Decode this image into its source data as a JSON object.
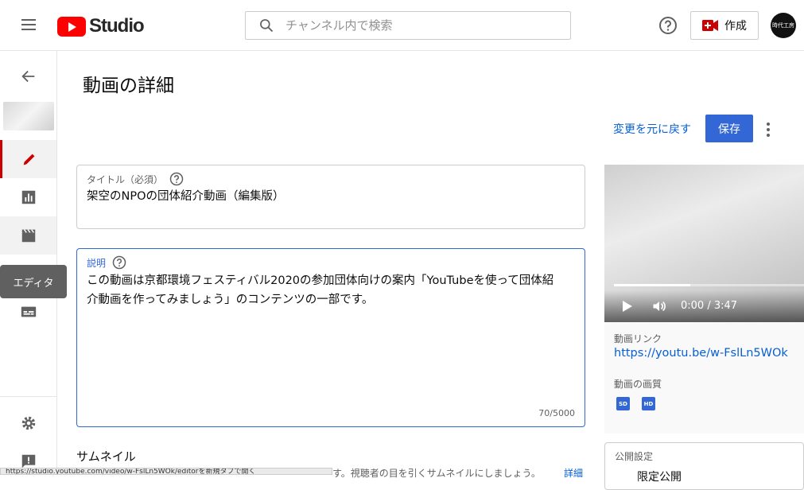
{
  "header": {
    "logo_text": "Studio",
    "search_placeholder": "チャンネル内で検索",
    "create_label": "作成",
    "avatar_text": "時代工房"
  },
  "sidebar": {
    "tooltip": "エディタ"
  },
  "main": {
    "page_title": "動画の詳細",
    "undo_label": "変更を元に戻す",
    "save_label": "保存",
    "title_field": {
      "label": "タイトル（必須）",
      "value": "架空のNPOの団体紹介動画（編集版）"
    },
    "description_field": {
      "label": "説明",
      "line1": "この動画は京都環境フェスティバル2020の参加団体向けの案内「YouTubeを使って団体紹",
      "line2": "介動画を作ってみましょう」のコンテンツの一部です。",
      "counter": "70/5000"
    },
    "thumbnail": {
      "heading": "サムネイル",
      "description": "す。視聴者の目を引くサムネイルにしましょう。",
      "more_link": "詳細"
    },
    "status_url": "https://studio.youtube.com/video/w-FslLn5WOk/editorを新規タブで開く"
  },
  "video": {
    "time": "0:00 / 3:47",
    "progress": 0.4,
    "link_label": "動画リンク",
    "link": "https://youtu.be/w-FslLn5WOk",
    "quality_label": "動画の画質",
    "quality_badges": [
      "SD",
      "HD"
    ]
  },
  "visibility": {
    "label": "公開設定",
    "value": "限定公開"
  },
  "colors": {
    "accent": "#3367d6",
    "link": "#065fd4",
    "brand_red": "#ff0000"
  }
}
